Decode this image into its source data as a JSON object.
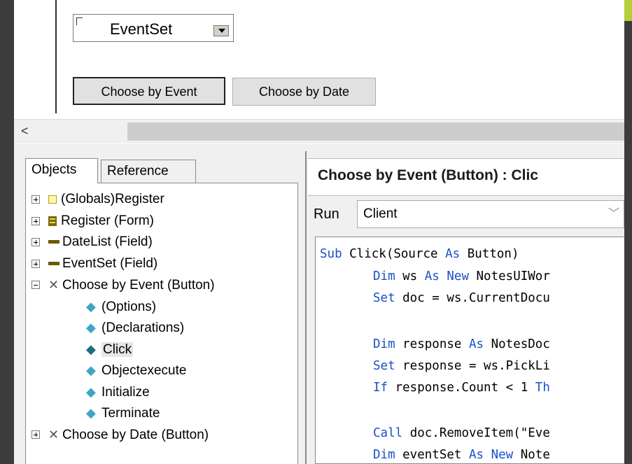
{
  "form": {
    "combo_value": "EventSet",
    "buttons": [
      "Choose by Event",
      "Choose by Date"
    ]
  },
  "scrollbar": {
    "left_arrow": "<"
  },
  "tabs": [
    "Objects",
    "Reference"
  ],
  "tree": [
    {
      "label": "(Globals)Register",
      "icon": "globals-icon"
    },
    {
      "label": "Register (Form)",
      "icon": "form-icon"
    },
    {
      "label": "DateList (Field)",
      "icon": "field-icon"
    },
    {
      "label": "EventSet (Field)",
      "icon": "field-icon"
    },
    {
      "label": "Choose by Event (Button)",
      "icon": "button-icon"
    },
    {
      "label": "(Options)",
      "icon": "event-icon"
    },
    {
      "label": "(Declarations)",
      "icon": "event-icon"
    },
    {
      "label": "Click",
      "icon": "event-icon"
    },
    {
      "label": "Objectexecute",
      "icon": "event-icon"
    },
    {
      "label": "Initialize",
      "icon": "event-icon"
    },
    {
      "label": "Terminate",
      "icon": "event-icon"
    },
    {
      "label": "Choose by Date (Button)",
      "icon": "button-icon"
    }
  ],
  "editor": {
    "title": "Choose by Event (Button) : Clic",
    "run_label": "Run",
    "run_value": "Client",
    "code": {
      "l1_kw": "Sub",
      "l1_b": " Click(Source ",
      "l1_kw2": "As",
      "l1_c": " Button)",
      "l2_kw": "Dim",
      "l2_b": " ws ",
      "l2_kw2": "As New",
      "l2_c": " NotesUIWor",
      "l3_kw": "Set",
      "l3_b": " doc = ws.CurrentDocu",
      "l4_kw": "Dim",
      "l4_b": " response ",
      "l4_kw2": "As",
      "l4_c": " NotesDoc",
      "l5_kw": "Set",
      "l5_b": " response = ws.PickLi",
      "l6_kw": "If",
      "l6_b": " response.Count < 1 ",
      "l6_kw2": "Th",
      "l7_kw": "Call",
      "l7_b": " doc.RemoveItem(\"Eve",
      "l8_kw": "Dim",
      "l8_b": " eventSet ",
      "l8_kw2": "As New",
      "l8_c": " Note"
    }
  },
  "colors": {
    "keyword": "#1a4fc8",
    "background_accent_orange": "#f6a000",
    "background_accent_lime": "#b5cf3c"
  }
}
